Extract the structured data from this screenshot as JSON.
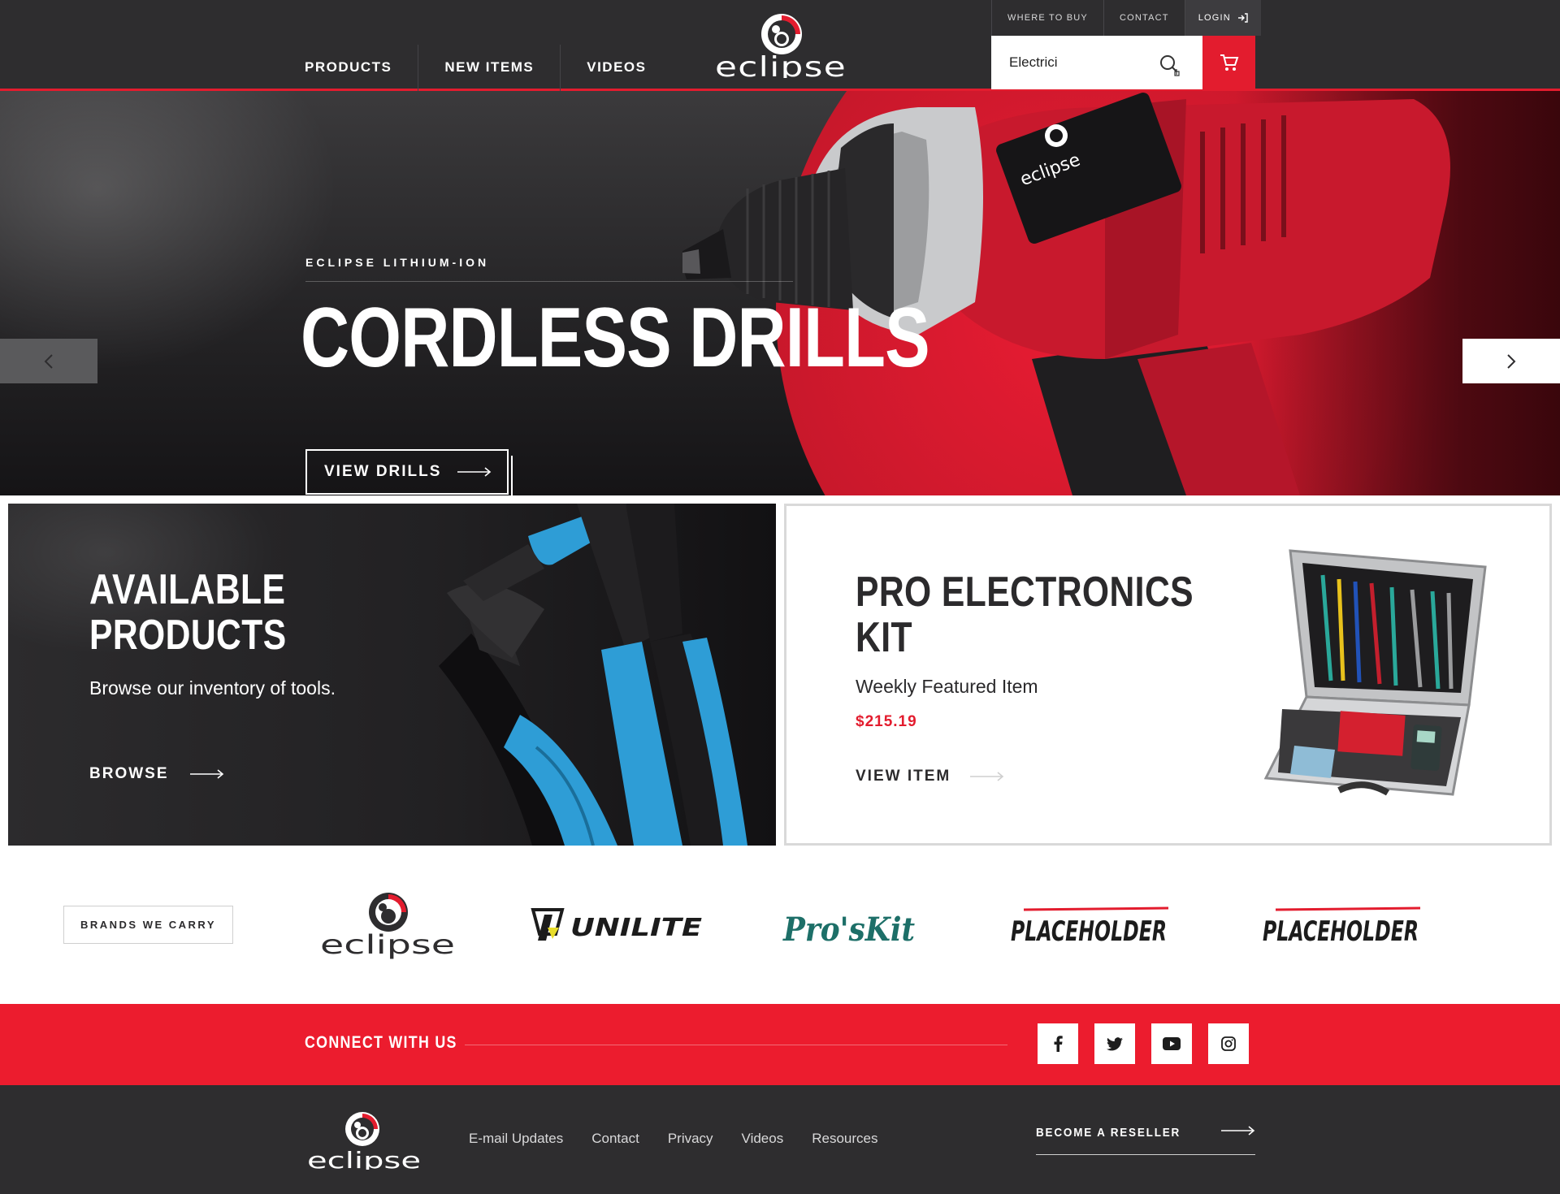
{
  "header": {
    "nav": [
      "PRODUCTS",
      "NEW ITEMS",
      "VIDEOS"
    ],
    "brand_name": "eclipse",
    "top_links": {
      "where_to_buy": "WHERE TO BUY",
      "contact": "CONTACT",
      "login": "LOGIN"
    },
    "search": {
      "value": "Electrici",
      "placeholder": ""
    }
  },
  "hero": {
    "eyebrow": "ECLIPSE LITHIUM-ION",
    "title": "CORDLESS DRILLS",
    "cta": "VIEW DRILLS"
  },
  "promo_left": {
    "title_line1": "AVAILABLE",
    "title_line2": "PRODUCTS",
    "subtitle": "Browse our inventory of tools.",
    "cta": "BROWSE"
  },
  "promo_right": {
    "title_line1": "PRO ELECTRONICS",
    "title_line2": "KIT",
    "subtitle": "Weekly Featured Item",
    "price": "$215.19",
    "cta": "VIEW ITEM"
  },
  "brands": {
    "label": "BRANDS WE CARRY",
    "items": [
      "eclipse",
      "UNILITE",
      "Pro'sKit",
      "PLACEHOLDER",
      "PLACEHOLDER"
    ]
  },
  "connect": {
    "title": "CONNECT WITH US",
    "socials": [
      "facebook-icon",
      "twitter-icon",
      "youtube-icon",
      "instagram-icon"
    ]
  },
  "footer": {
    "links": [
      "E-mail Updates",
      "Contact",
      "Privacy",
      "Videos",
      "Resources"
    ],
    "reseller": "BECOME A RESELLER"
  },
  "colors": {
    "accent": "#e31c2e",
    "dark": "#2e2d2f",
    "teal": "#1d6f68"
  }
}
